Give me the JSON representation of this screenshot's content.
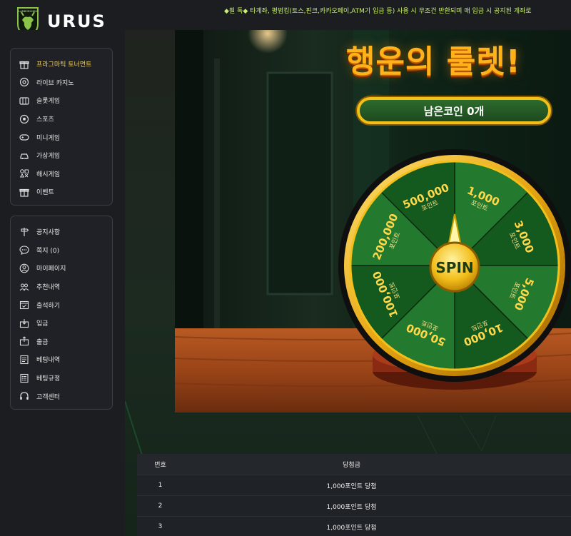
{
  "header": {
    "logo_text": "URUS",
    "logo_badge_text": "LAMBORGHINI",
    "notice": "◆필 독◆ 타계좌, 평범킹(토스,핀크,카카오페이,ATM기 입금 등) 사용 시 무조건 반환되며 매 입금 시 공지된 계좌로"
  },
  "sidebar": {
    "group1": [
      {
        "label": "프라그마틱 토너먼트",
        "icon": "gift-icon",
        "active": true
      },
      {
        "label": "라이브 카지노",
        "icon": "casino-chip-icon"
      },
      {
        "label": "슬롯게임",
        "icon": "slot-machine-icon"
      },
      {
        "label": "스포츠",
        "icon": "soccer-ball-icon"
      },
      {
        "label": "미니게임",
        "icon": "gamepad-icon"
      },
      {
        "label": "가상게임",
        "icon": "virtual-car-icon"
      },
      {
        "label": "해시게임",
        "icon": "hash-shapes-icon"
      },
      {
        "label": "이벤트",
        "icon": "gift-box-icon"
      }
    ],
    "group2": [
      {
        "label": "공지사항",
        "icon": "signpost-icon"
      },
      {
        "label": "쪽지 (0)",
        "icon": "chat-bubble-icon"
      },
      {
        "label": "마이페이지",
        "icon": "user-circle-icon"
      },
      {
        "label": "추천내역",
        "icon": "users-icon"
      },
      {
        "label": "출석하기",
        "icon": "calendar-check-icon"
      },
      {
        "label": "입금",
        "icon": "deposit-icon"
      },
      {
        "label": "출금",
        "icon": "withdraw-icon"
      },
      {
        "label": "베팅내역",
        "icon": "bet-history-icon"
      },
      {
        "label": "베팅규정",
        "icon": "rules-list-icon"
      },
      {
        "label": "고객센터",
        "icon": "headset-icon"
      }
    ]
  },
  "roulette": {
    "title": "행운의 룰렛!",
    "coins_label": "남은코인 0개",
    "spin_label": "SPIN",
    "segments": [
      {
        "amount": "1,000",
        "unit": "포인트"
      },
      {
        "amount": "3,000",
        "unit": "포인트"
      },
      {
        "amount": "5,000",
        "unit": "포인트"
      },
      {
        "amount": "10,000",
        "unit": "포인트"
      },
      {
        "amount": "50,000",
        "unit": "포인트"
      },
      {
        "amount": "100,000",
        "unit": "포인트"
      },
      {
        "amount": "200,000",
        "unit": "포인트"
      },
      {
        "amount": "500,000",
        "unit": "포인트"
      }
    ]
  },
  "results_table": {
    "columns": {
      "no": "번호",
      "prize": "당첨금"
    },
    "rows": [
      {
        "no": "1",
        "prize": "1,000포인트 당첨"
      },
      {
        "no": "2",
        "prize": "1,000포인트 당첨"
      },
      {
        "no": "3",
        "prize": "1,000포인트 당첨"
      }
    ]
  },
  "colors": {
    "accent_gold": "#f3c01a",
    "wheel_green": "#237a2e",
    "wheel_dark_green": "#145a1f",
    "notice_green": "#c8f06a"
  }
}
